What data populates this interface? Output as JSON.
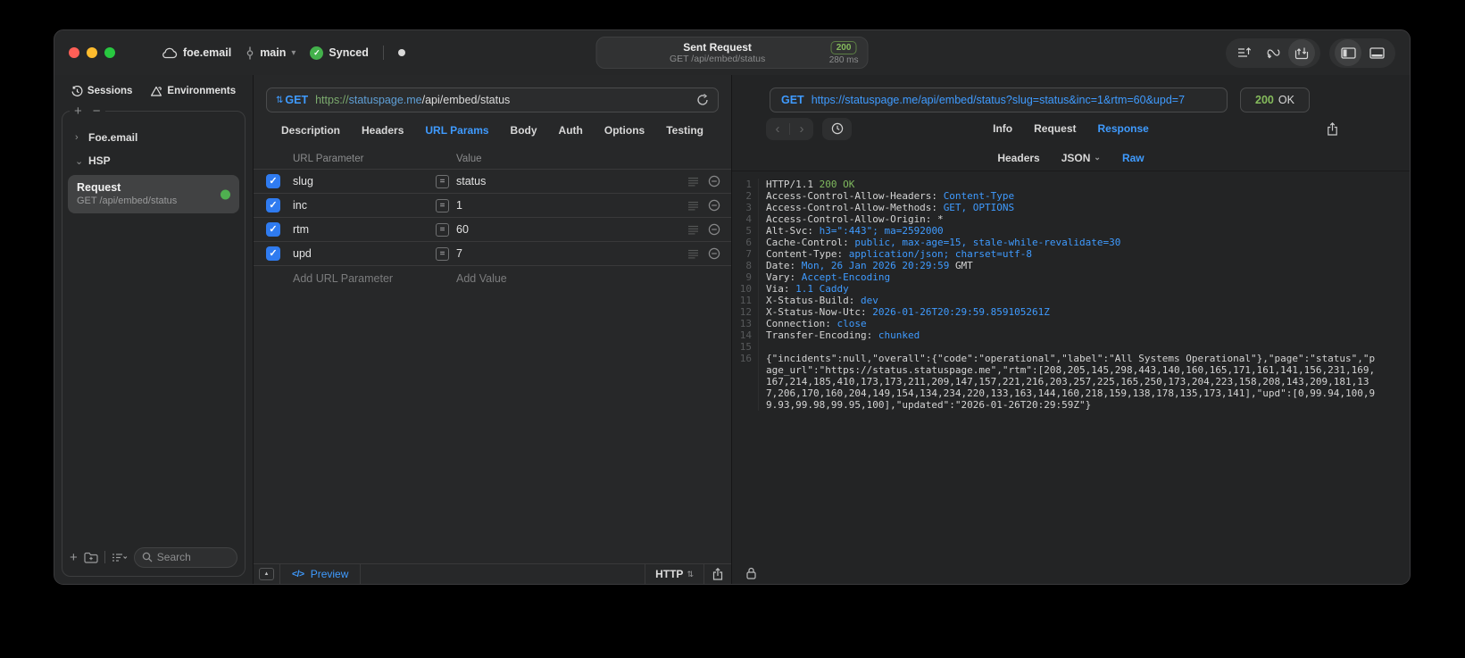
{
  "titlebar": {
    "project": "foe.email",
    "branch": "main",
    "sync_status": "Synced",
    "request_summary": {
      "title": "Sent Request",
      "subtitle": "GET /api/embed/status",
      "status_code": "200",
      "duration": "280 ms"
    }
  },
  "sidebar": {
    "tabs": [
      {
        "label": "Sessions",
        "icon": "history-icon"
      },
      {
        "label": "Environments",
        "icon": "environments-icon"
      }
    ],
    "tree": [
      {
        "label": "Foe.email",
        "expanded": false
      },
      {
        "label": "HSP",
        "expanded": true
      }
    ],
    "request_item": {
      "title": "Request",
      "subtitle": "GET /api/embed/status",
      "status": "success"
    },
    "search": {
      "placeholder": "Search"
    }
  },
  "request": {
    "method": "GET",
    "url": {
      "scheme": "https://",
      "host": "statuspage.me",
      "path": "/api/embed/status"
    },
    "tabs": [
      "Description",
      "Headers",
      "URL Params",
      "Body",
      "Auth",
      "Options",
      "Testing"
    ],
    "active_tab": "URL Params",
    "params": {
      "columns": [
        "URL Parameter",
        "Value"
      ],
      "rows": [
        {
          "name": "slug",
          "value": "status",
          "enabled": true
        },
        {
          "name": "inc",
          "value": "1",
          "enabled": true
        },
        {
          "name": "rtm",
          "value": "60",
          "enabled": true
        },
        {
          "name": "upd",
          "value": "7",
          "enabled": true
        }
      ],
      "add_param_label": "Add URL Parameter",
      "add_value_label": "Add Value"
    },
    "footer": {
      "preview_label": "Preview",
      "protocol": "HTTP"
    }
  },
  "response": {
    "method": "GET",
    "url": "https://statuspage.me/api/embed/status?slug=status&inc=1&rtm=60&upd=7",
    "status_code": "200",
    "status_text": "OK",
    "tabs": [
      "Info",
      "Request",
      "Response"
    ],
    "active_tab": "Response",
    "subtabs": [
      {
        "label": "Headers",
        "has_menu": false
      },
      {
        "label": "JSON",
        "has_menu": true
      },
      {
        "label": "Raw",
        "has_menu": false
      }
    ],
    "active_subtab": "Raw",
    "colors": {
      "accent": "#3f9bff",
      "success_green": "#85bb5c"
    },
    "raw_lines": [
      {
        "n": "1",
        "segs": [
          [
            "HTTP/1.1 ",
            "plain"
          ],
          [
            "200 OK",
            "green"
          ]
        ]
      },
      {
        "n": "2",
        "segs": [
          [
            "Access-Control-Allow-Headers: ",
            "plain"
          ],
          [
            "Content-Type",
            "blue"
          ]
        ]
      },
      {
        "n": "3",
        "segs": [
          [
            "Access-Control-Allow-Methods: ",
            "plain"
          ],
          [
            "GET, OPTIONS",
            "blue"
          ]
        ]
      },
      {
        "n": "4",
        "segs": [
          [
            "Access-Control-Allow-Origin: *",
            "plain"
          ]
        ]
      },
      {
        "n": "5",
        "segs": [
          [
            "Alt-Svc: ",
            "plain"
          ],
          [
            "h3=\":443\"; ma=2592000",
            "blue"
          ]
        ]
      },
      {
        "n": "6",
        "segs": [
          [
            "Cache-Control: ",
            "plain"
          ],
          [
            "public, max-age=15, stale-while-revalidate=30",
            "blue"
          ]
        ]
      },
      {
        "n": "7",
        "segs": [
          [
            "Content-Type: ",
            "plain"
          ],
          [
            "application/json; charset=utf-8",
            "blue"
          ]
        ]
      },
      {
        "n": "8",
        "segs": [
          [
            "Date: ",
            "plain"
          ],
          [
            "Mon, 26 Jan 2026 20:29:59 ",
            "blue"
          ],
          [
            "GMT",
            "plain"
          ]
        ]
      },
      {
        "n": "9",
        "segs": [
          [
            "Vary: ",
            "plain"
          ],
          [
            "Accept-Encoding",
            "blue"
          ]
        ]
      },
      {
        "n": "10",
        "segs": [
          [
            "Via: ",
            "plain"
          ],
          [
            "1.1 Caddy",
            "blue"
          ]
        ]
      },
      {
        "n": "11",
        "segs": [
          [
            "X-Status-Build: ",
            "plain"
          ],
          [
            "dev",
            "blue"
          ]
        ]
      },
      {
        "n": "12",
        "segs": [
          [
            "X-Status-Now-Utc: ",
            "plain"
          ],
          [
            "2026-01-26T20:29:59.859105261Z",
            "blue"
          ]
        ]
      },
      {
        "n": "13",
        "segs": [
          [
            "Connection: ",
            "plain"
          ],
          [
            "close",
            "blue"
          ]
        ]
      },
      {
        "n": "14",
        "segs": [
          [
            "Transfer-Encoding: ",
            "plain"
          ],
          [
            "chunked",
            "blue"
          ]
        ]
      },
      {
        "n": "15",
        "segs": []
      },
      {
        "n": "16",
        "segs": [
          [
            "{\"incidents\":null,\"overall\":{\"code\":\"operational\",\"label\":\"All Systems Operational\"},\"page\":\"status\",\"page_url\":\"https://status.statuspage.me\",\"rtm\":[208,205,145,298,443,140,160,165,171,161,141,156,231,169,167,214,185,410,173,173,211,209,147,157,221,216,203,257,225,165,250,173,204,223,158,208,143,209,181,137,206,170,160,204,149,154,134,234,220,133,163,144,160,218,159,138,178,135,173,141],\"upd\":[0,99.94,100,99.93,99.98,99.95,100],\"updated\":\"2026-01-26T20:29:59Z\"}",
            "plain"
          ]
        ]
      }
    ]
  }
}
